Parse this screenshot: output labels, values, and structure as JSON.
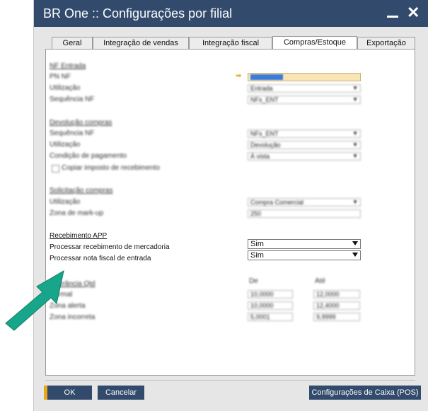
{
  "window": {
    "title": "BR One :: Configurações por filial"
  },
  "tabs": [
    {
      "label": "Geral",
      "active": false
    },
    {
      "label": "Integração de vendas",
      "active": false
    },
    {
      "label": "Integração fiscal",
      "active": false
    },
    {
      "label": "Compras/Estoque",
      "active": true
    },
    {
      "label": "Exportação",
      "active": false
    }
  ],
  "nf_entrada": {
    "section_title": "NF Entrada",
    "rows": [
      {
        "label": "PN NF",
        "value": ""
      },
      {
        "label": "Utilização",
        "value": "Entrada"
      },
      {
        "label": "Sequência NF",
        "value": "NFs_ENT"
      }
    ]
  },
  "devolucao": {
    "section_title": "Devolução compras",
    "rows": [
      {
        "label": "Sequência NF",
        "value": "NFs_ENT"
      },
      {
        "label": "Utilização",
        "value": "Devolução"
      },
      {
        "label": "Condição de pagamento",
        "value": "À vista"
      }
    ],
    "checkbox_label": "Copiar imposto de recebimento"
  },
  "solicitacao": {
    "section_title": "Solicitação compras",
    "rows": [
      {
        "label": "Utilização",
        "value": "Compra Comercial"
      },
      {
        "label": "Zona de mark-up",
        "value": "250"
      }
    ]
  },
  "recebimento": {
    "section_title": "Recebimento APP",
    "rows": [
      {
        "label": "Processar recebimento de mercadoria",
        "value": "Sim"
      },
      {
        "label": "Processar nota fiscal de entrada",
        "value": "Sim"
      }
    ]
  },
  "tolerancia": {
    "section_title": "Tolerância Qtd",
    "col_de": "De",
    "col_ate": "Até",
    "rows": [
      {
        "label": "Normal",
        "de": "10,0000",
        "ate": "12,0000"
      },
      {
        "label": "Zona alerta",
        "de": "10,0000",
        "ate": "12,4000"
      },
      {
        "label": "Zona incorreta",
        "de": "5,0001",
        "ate": "9,9999"
      }
    ]
  },
  "buttons": {
    "ok": "OK",
    "cancel": "Cancelar",
    "pos": "Configurações de Caixa (POS)"
  },
  "colors": {
    "titlebar": "#324a6b",
    "ok_accent": "#e8a81c",
    "annotation_arrow": "#17a689"
  }
}
